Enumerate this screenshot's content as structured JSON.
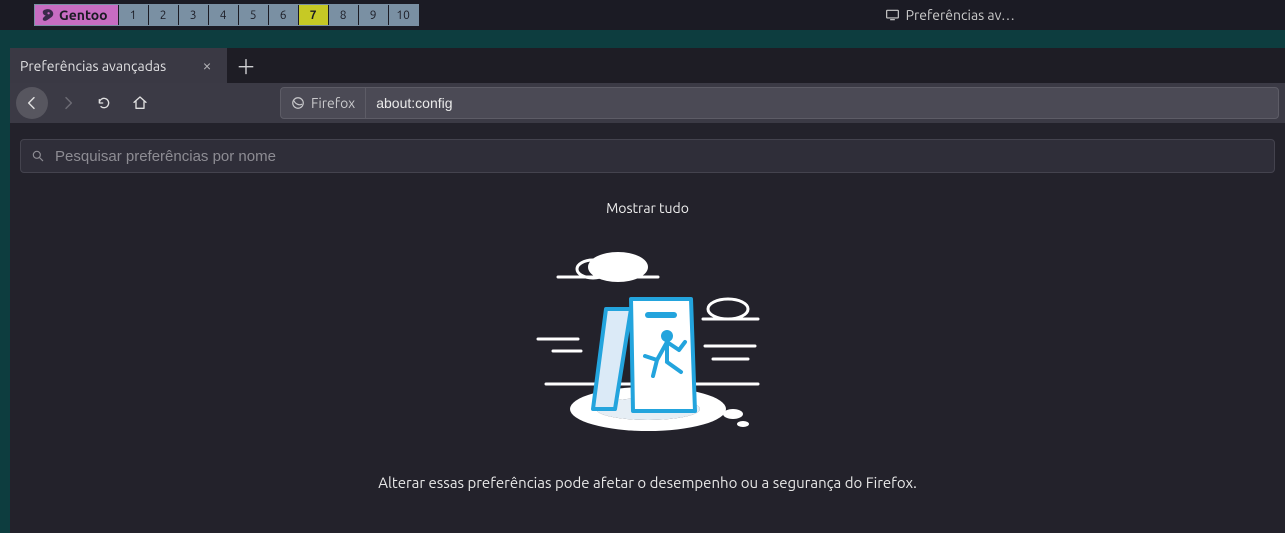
{
  "wm": {
    "distro_label": "Gentoo",
    "workspaces": [
      "1",
      "2",
      "3",
      "4",
      "5",
      "6",
      "7",
      "8",
      "9",
      "10"
    ],
    "active_workspace": "7",
    "current_window_title": "Preferências av…"
  },
  "browser": {
    "tab_title": "Preferências avançadas",
    "identity_label": "Firefox",
    "url": "about:config"
  },
  "aboutconfig": {
    "search_placeholder": "Pesquisar preferências por nome",
    "show_all_label": "Mostrar tudo",
    "warning_text": "Alterar essas preferências pode afetar o desempenho ou a segurança do Firefox."
  }
}
